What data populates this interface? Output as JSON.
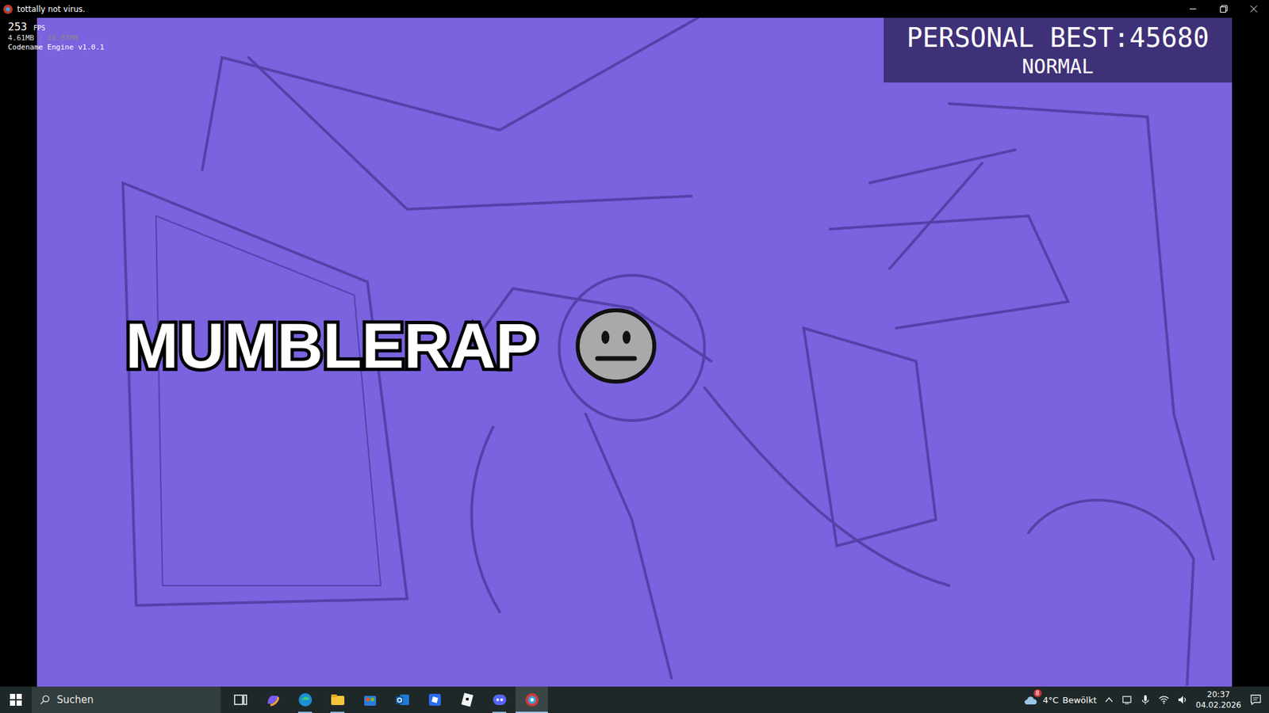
{
  "window": {
    "title": "tottally not virus."
  },
  "debug": {
    "fps": "253",
    "fps_unit": "FPS",
    "memory": "4.61MB",
    "memory_peak": "/ 28.87MB",
    "engine": "Codename Engine v1.0.1"
  },
  "score": {
    "label": "PERSONAL BEST:",
    "value": "45680",
    "difficulty": "NORMAL"
  },
  "song": {
    "title": "MUMBLERAP"
  },
  "taskbar": {
    "search": "Suchen",
    "apps": [
      {
        "kind": "taskview",
        "running": false,
        "active": false
      },
      {
        "kind": "copilot",
        "running": false,
        "active": false
      },
      {
        "kind": "edge",
        "running": true,
        "active": false
      },
      {
        "kind": "explorer",
        "running": true,
        "active": false
      },
      {
        "kind": "store",
        "running": false,
        "active": false
      },
      {
        "kind": "outlook",
        "running": false,
        "active": false
      },
      {
        "kind": "roblox",
        "running": false,
        "active": false
      },
      {
        "kind": "studio",
        "running": false,
        "active": false
      },
      {
        "kind": "discord",
        "running": true,
        "active": false
      },
      {
        "kind": "game",
        "running": true,
        "active": true
      }
    ],
    "weather": {
      "badge": "8",
      "temp": "4°C",
      "condition": "Bewölkt"
    },
    "clock": {
      "time": "20:37",
      "date": "04.02.2026"
    }
  }
}
